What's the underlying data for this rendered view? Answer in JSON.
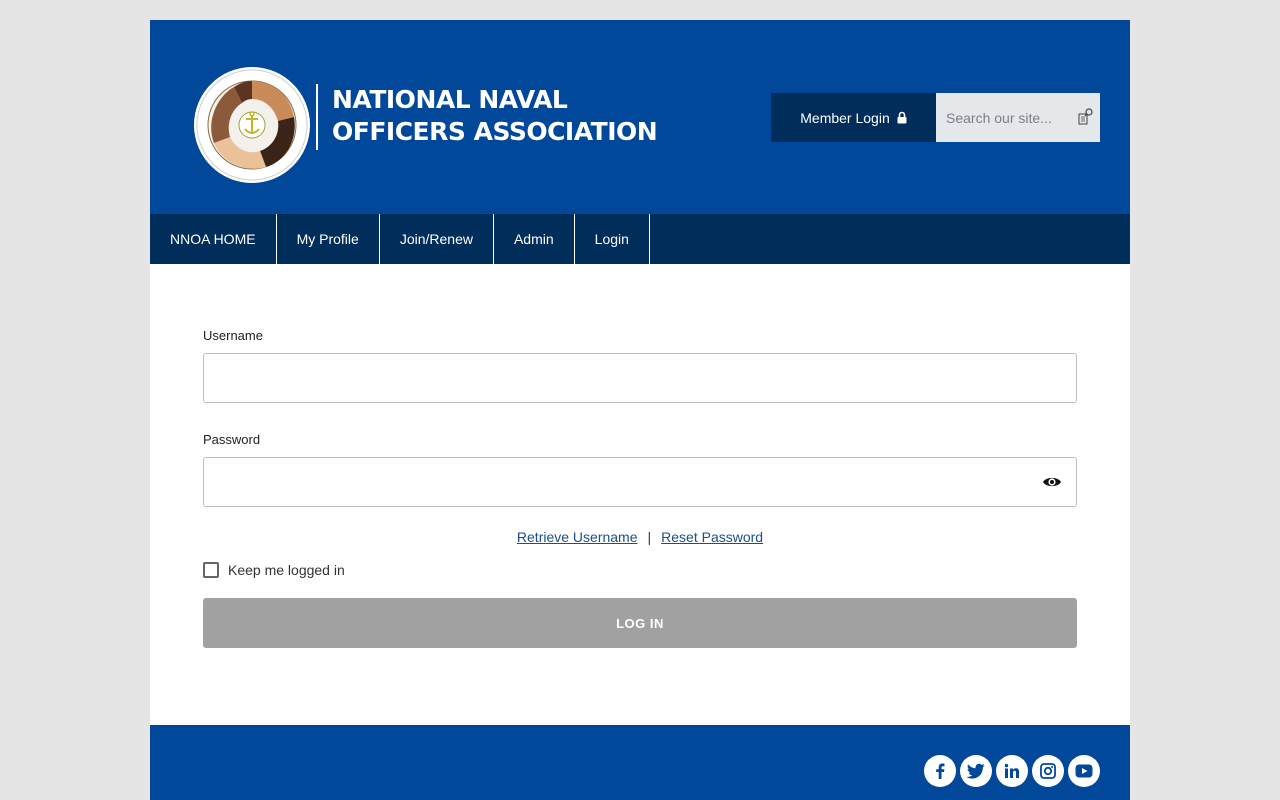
{
  "header": {
    "logo_line1": "NATIONAL NAVAL",
    "logo_line2": "OFFICERS ASSOCIATION",
    "member_login_label": "Member Login",
    "search_placeholder": "Search our site..."
  },
  "nav": {
    "items": [
      {
        "label": "NNOA HOME"
      },
      {
        "label": "My Profile"
      },
      {
        "label": "Join/Renew"
      },
      {
        "label": "Admin"
      },
      {
        "label": "Login"
      }
    ]
  },
  "form": {
    "username_label": "Username",
    "username_value": "",
    "password_label": "Password",
    "password_value": "",
    "retrieve_username": "Retrieve Username",
    "separator": "|",
    "reset_password": "Reset Password",
    "keep_logged_in": "Keep me logged in",
    "keep_logged_in_checked": false,
    "login_button": "LOG IN"
  },
  "footer": {
    "social_icons": [
      "facebook-icon",
      "twitter-icon",
      "linkedin-icon",
      "instagram-icon",
      "youtube-icon"
    ]
  },
  "colors": {
    "brand_blue": "#01479a",
    "dark_navy": "#012d5b",
    "page_bg": "#e5e5e5",
    "disabled_button": "#a1a1a1",
    "link": "#1a4f8b"
  }
}
